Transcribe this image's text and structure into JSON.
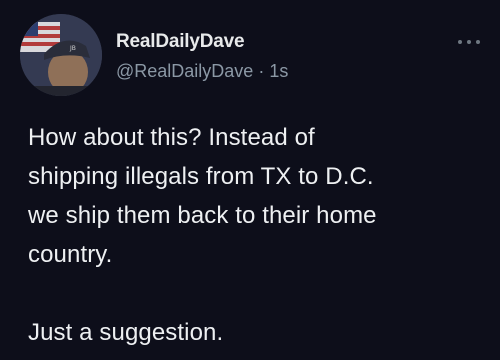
{
  "author": {
    "display_name": "RealDailyDave",
    "handle": "@RealDailyDave",
    "separator": "·",
    "timestamp": "1s",
    "avatar_icon": "user-photo-with-flag-avatar"
  },
  "post": {
    "lines": [
      "How about this? Instead of",
      "shipping illegals from TX to D.C.",
      "we ship them back to their home",
      "country."
    ],
    "closing": "Just a suggestion."
  },
  "menu": {
    "icon": "more-options-icon"
  },
  "colors": {
    "background": "#0d0e1a",
    "text": "#e7e9ea",
    "secondary_text": "#8b98a5"
  }
}
